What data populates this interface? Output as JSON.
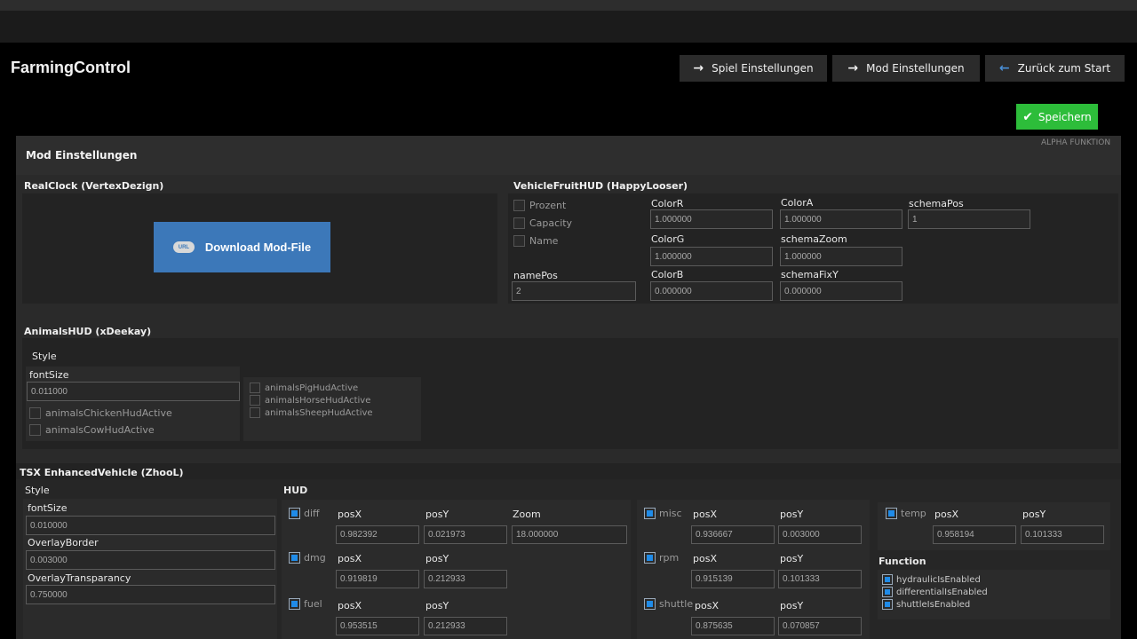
{
  "app": {
    "title": "FarmingControl"
  },
  "nav": {
    "game_settings": "Spiel Einstellungen",
    "mod_settings": "Mod Einstellungen",
    "back_to_start": "Zurück zum Start"
  },
  "save_label": "Speichern",
  "panel": {
    "title": "Mod Einstellungen",
    "badge": "ALPHA FUNKTION"
  },
  "realclock": {
    "title": "RealClock (VertexDezign)",
    "download_label": "Download Mod-File",
    "download_icon_text": "URL"
  },
  "vfh": {
    "title": "VehicleFruitHUD (HappyLooser)",
    "checks": [
      "Prozent",
      "Capacity",
      "Name"
    ],
    "namePos_label": "namePos",
    "namePos_value": "2",
    "colorR_label": "ColorR",
    "colorR_value": "1.000000",
    "colorG_label": "ColorG",
    "colorG_value": "1.000000",
    "colorB_label": "ColorB",
    "colorB_value": "0.000000",
    "colorA_label": "ColorA",
    "colorA_value": "1.000000",
    "schemaZoom_label": "schemaZoom",
    "schemaZoom_value": "1.000000",
    "schemaFixY_label": "schemaFixY",
    "schemaFixY_value": "0.000000",
    "schemaPos_label": "schemaPos",
    "schemaPos_value": "1"
  },
  "animals": {
    "title": "AnimalsHUD (xDeekay)",
    "style_label": "Style",
    "fontSize_label": "fontSize",
    "fontSize_value": "0.011000",
    "chicken": "animalsChickenHudActive",
    "cow": "animalsCowHudActive",
    "pig": "animalsPigHudActive",
    "horse": "animalsHorseHudActive",
    "sheep": "animalsSheepHudActive"
  },
  "tsx": {
    "title": "TSX EnhancedVehicle (ZhooL)",
    "style_label": "Style",
    "hud_label": "HUD",
    "fontSize_label": "fontSize",
    "fontSize_value": "0.010000",
    "overlayBorder_label": "OverlayBorder",
    "overlayBorder_value": "0.003000",
    "overlayTransparancy_label": "OverlayTransparancy",
    "overlayTransparancy_value": "0.750000",
    "posX_label": "posX",
    "posY_label": "posY",
    "zoom_label": "Zoom",
    "diff": {
      "name": "diff",
      "posX": "0.982392",
      "posY": "0.021973",
      "zoom": "18.000000"
    },
    "dmg": {
      "name": "dmg",
      "posX": "0.919819",
      "posY": "0.212933"
    },
    "fuel": {
      "name": "fuel",
      "posX": "0.953515",
      "posY": "0.212933"
    },
    "misc": {
      "name": "misc",
      "posX": "0.936667",
      "posY": "0.003000"
    },
    "rpm": {
      "name": "rpm",
      "posX": "0.915139",
      "posY": "0.101333"
    },
    "shuttle": {
      "name": "shuttle",
      "posX": "0.875635",
      "posY": "0.070857"
    },
    "temp": {
      "name": "temp",
      "posX": "0.958194",
      "posY": "0.101333"
    },
    "function_label": "Function",
    "functions": [
      "hydraulicIsEnabled",
      "differentialIsEnabled",
      "shuttleIsEnabled"
    ]
  },
  "colors": {
    "save_green": "#2dbd3a",
    "download_blue": "#3c78b9",
    "check_blue": "#1f8be8"
  }
}
